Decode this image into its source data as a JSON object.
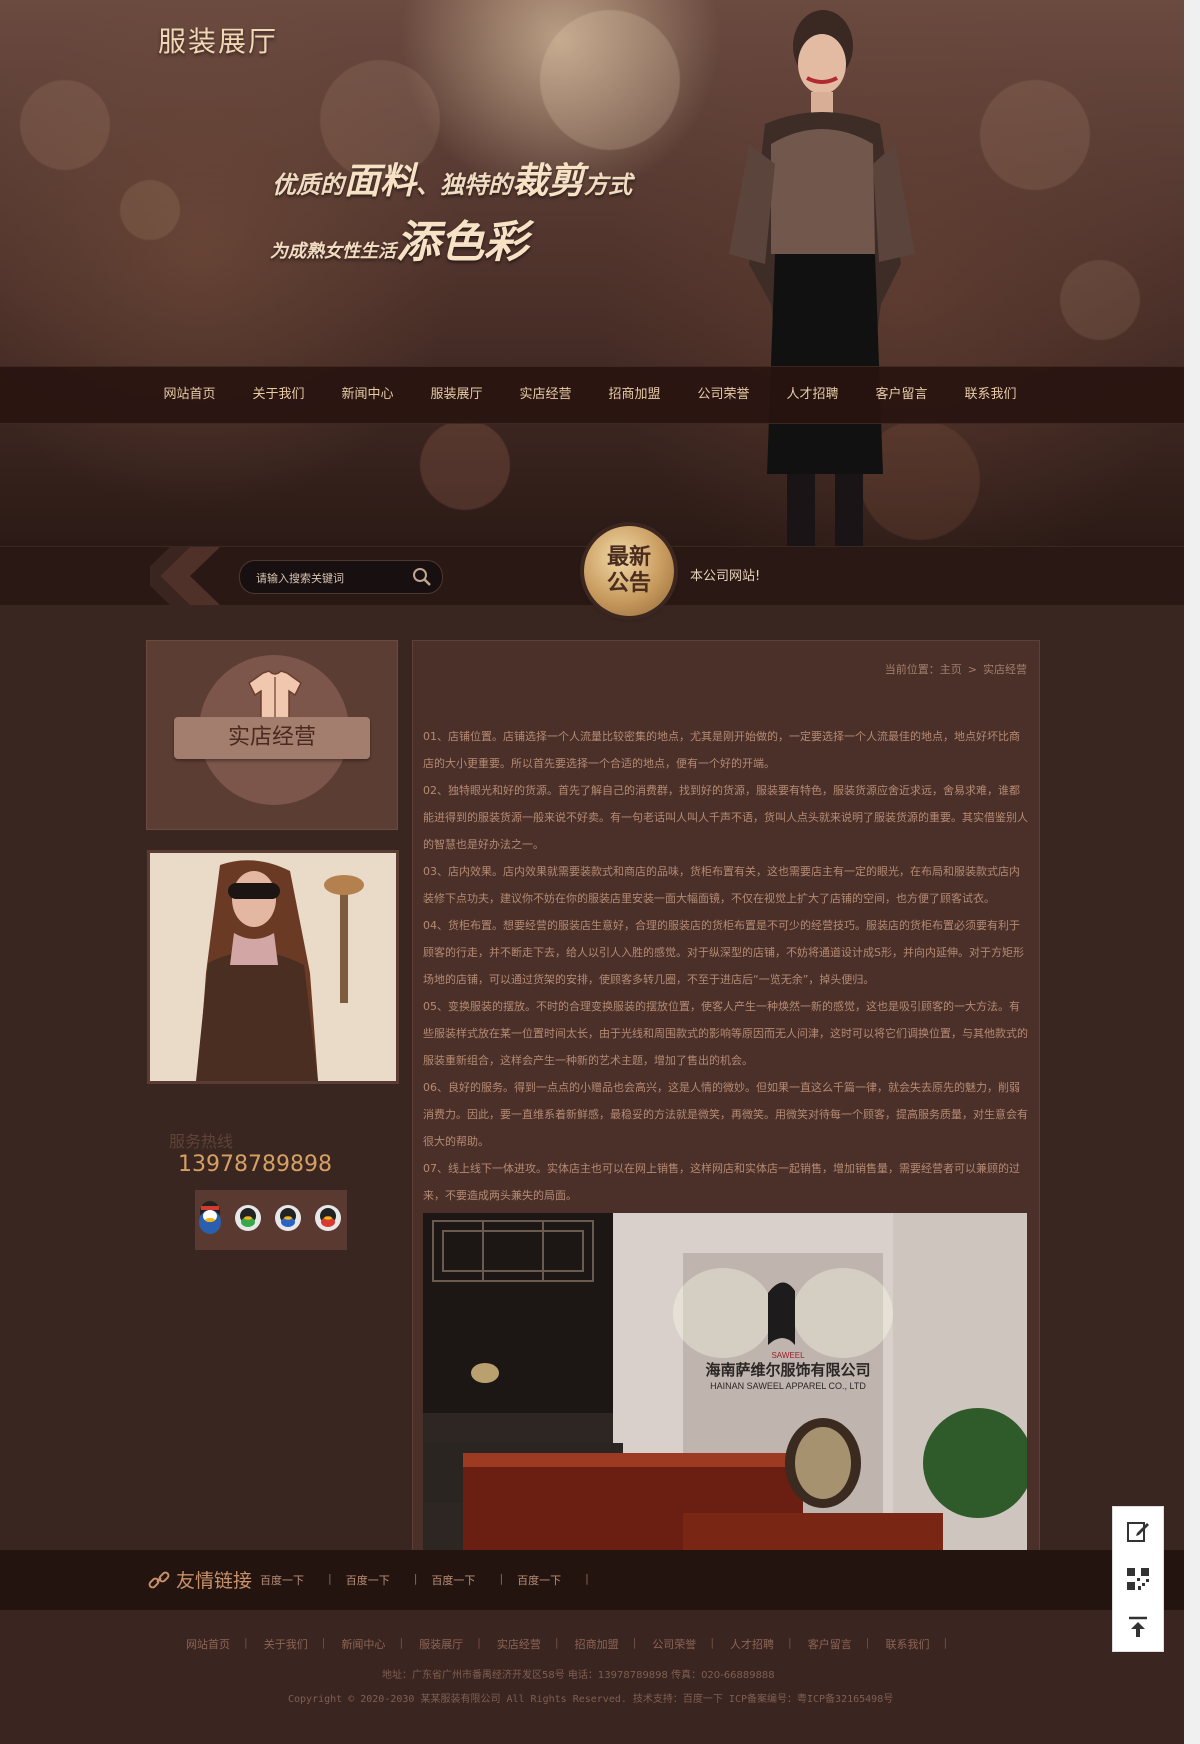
{
  "header": {
    "logo": "服装展厅",
    "slogan_line1_a": "优质的",
    "slogan_line1_b": "面料",
    "slogan_line1_c": "、独特的",
    "slogan_line1_d": "裁剪",
    "slogan_line1_e": "方式",
    "slogan_line2_a": "为成熟女性生活",
    "slogan_line2_b": "添色彩"
  },
  "nav": {
    "items": [
      {
        "label": "网站首页"
      },
      {
        "label": "关于我们"
      },
      {
        "label": "新闻中心"
      },
      {
        "label": "服装展厅"
      },
      {
        "label": "实店经营"
      },
      {
        "label": "招商加盟"
      },
      {
        "label": "公司荣誉"
      },
      {
        "label": "人才招聘"
      },
      {
        "label": "客户留言"
      },
      {
        "label": "联系我们"
      }
    ]
  },
  "search": {
    "placeholder": "请输入搜索关键词"
  },
  "notice": {
    "badge_line1": "最新",
    "badge_line2": "公告",
    "text": "本公司网站!"
  },
  "sidebar": {
    "title": "实店经营",
    "hotline_label": "服务热线",
    "hotline_number": "13978789898"
  },
  "breadcrumb": {
    "prefix": "当前位置：",
    "home": "主页",
    "sep": ">",
    "current": "实店经营"
  },
  "article": {
    "paragraphs": [
      "01、店铺位置。店铺选择一个人流量比较密集的地点，尤其是刚开始做的，一定要选择一个人流最佳的地点，地点好坏比商店的大小更重要。所以首先要选择一个合适的地点，便有一个好的开端。",
      "02、独特眼光和好的货源。首先了解自己的消费群，找到好的货源，服装要有特色，服装货源应舍近求远，舍易求难，谁都能进得到的服装货源一般来说不好卖。有一句老话叫人叫人千声不语，货叫人点头就来说明了服装货源的重要。其实借鉴别人的智慧也是好办法之一。",
      "03、店内效果。店内效果就需要装款式和商店的品味，货柜布置有关，这也需要店主有一定的眼光，在布局和服装款式店内装修下点功夫，建议你不妨在你的服装店里安装一面大幅面镜，不仅在视觉上扩大了店铺的空间，也方便了顾客试衣。",
      "04、货柜布置。想要经营的服装店生意好，合理的服装店的货柜布置是不可少的经营技巧。服装店的货柜布置必须要有利于顾客的行走，并不断走下去，给人以引人入胜的感觉。对于纵深型的店铺，不妨将通道设计成S形，并向内延伸。对于方矩形场地的店铺，可以通过货架的安排，使顾客多转几圈，不至于进店后“一览无余”，掉头便归。",
      "05、变换服装的摆放。不时的合理变换服装的摆放位置，使客人产生一种焕然一新的感觉，这也是吸引顾客的一大方法。有些服装样式放在某一位置时间太长，由于光线和周围款式的影响等原因而无人问津，这时可以将它们调换位置，与其他款式的服装重新组合，这样会产生一种新的艺术主题，增加了售出的机会。",
      "06、良好的服务。得到一点点的小赠品也会高兴，这是人情的微妙。但如果一直这么千篇一律，就会失去原先的魅力，削弱消费力。因此，要一直维系着新鲜感，最稳妥的方法就是微笑，再微笑。用微笑对待每一个顾客，提高服务质量，对生意会有很大的帮助。",
      "07、线上线下一体进攻。实体店主也可以在网上销售，这样网店和实体店一起销售，增加销售量，需要经营者可以兼顾的过来，不要造成两头兼失的局面。"
    ]
  },
  "photo_sign": {
    "company_cn": "海南萨维尔服饰有限公司",
    "company_en": "HAINAN SAWEEL APPAREL CO., LTD",
    "brand": "SAWEEL"
  },
  "links": {
    "title": "友情链接",
    "items": [
      "百度一下",
      "百度一下",
      "百度一下",
      "百度一下"
    ]
  },
  "footer": {
    "nav": [
      "网站首页",
      "关于我们",
      "新闻中心",
      "服装展厅",
      "实店经营",
      "招商加盟",
      "公司荣誉",
      "人才招聘",
      "客户留言",
      "联系我们"
    ],
    "address": "地址：广东省广州市番禺经济开发区58号    电话：13978789898    传真：020-66889888",
    "copyright": "Copyright © 2020-2030 某某服装有限公司 All Rights Reserved.    技术支持：百度一下    ICP备案编号：粤ICP备32165498号"
  },
  "colors": {
    "background": "#3a2620",
    "nav_text": "#e7cba6",
    "hotline": "#d6a064",
    "article_text": "#b58a72"
  },
  "icons": [
    "search-icon",
    "shirt-icon",
    "qq-icon",
    "link-icon",
    "edit-icon",
    "qrcode-icon",
    "back-to-top-icon"
  ]
}
